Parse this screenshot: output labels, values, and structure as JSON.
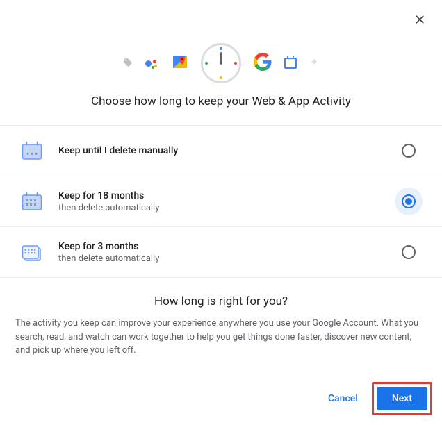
{
  "title": "Choose how long to keep your Web & App Activity",
  "options": [
    {
      "label": "Keep until I delete manually",
      "sub": "",
      "selected": false
    },
    {
      "label": "Keep for 18 months",
      "sub": "then delete automatically",
      "selected": true
    },
    {
      "label": "Keep for 3 months",
      "sub": "then delete automatically",
      "selected": false
    }
  ],
  "explain": {
    "heading": "How long is right for you?",
    "body": "The activity you keep can improve your experience anywhere you use your Google Account. What you search, read, and watch can work together to help you get things done faster, discover new content, and pick up where you left off."
  },
  "buttons": {
    "cancel": "Cancel",
    "next": "Next"
  }
}
